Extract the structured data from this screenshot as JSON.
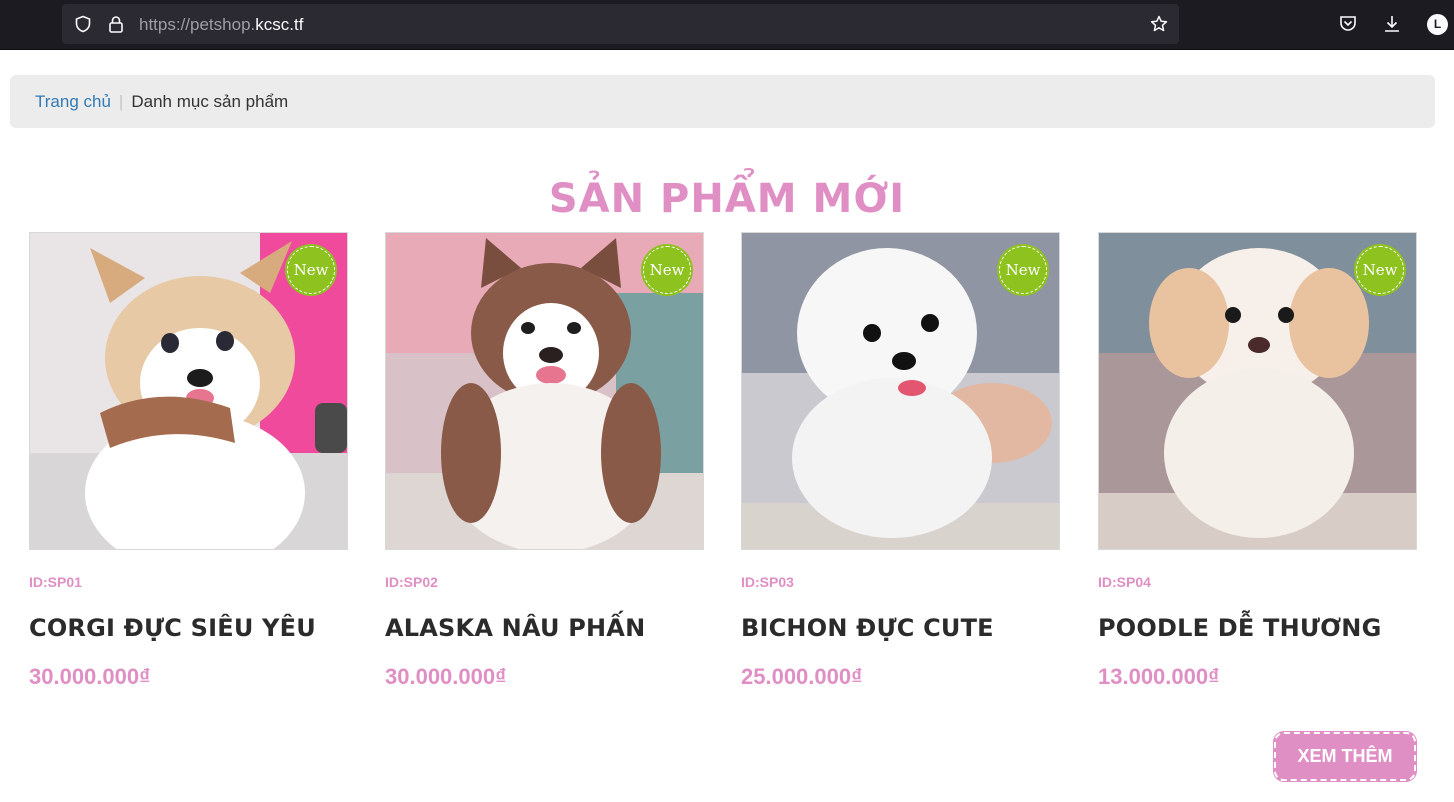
{
  "browser": {
    "url_scheme": "https://petshop.",
    "url_host": "kcsc.tf",
    "profile_initial": "L"
  },
  "breadcrumb": {
    "home": "Trang chủ",
    "separator": "|",
    "current": "Danh mục sản phẩm"
  },
  "section": {
    "title": "SẢN PHẨM MỚI"
  },
  "badge_label": "New",
  "products": [
    {
      "id": "ID:SP01",
      "name": "CORGI ĐỰC SIÊU YÊU",
      "price": "30.000.000₫"
    },
    {
      "id": "ID:SP02",
      "name": "ALASKA NÂU PHẤN",
      "price": "30.000.000₫"
    },
    {
      "id": "ID:SP03",
      "name": "BICHON ĐỰC CUTE",
      "price": "25.000.000₫"
    },
    {
      "id": "ID:SP04",
      "name": "POODLE DỄ THƯƠNG",
      "price": "13.000.000₫"
    }
  ],
  "more_button": "XEM THÊM",
  "colors": {
    "accent_pink": "#e08fc4",
    "badge_green": "#8dc21f",
    "link_blue": "#337ab7"
  }
}
